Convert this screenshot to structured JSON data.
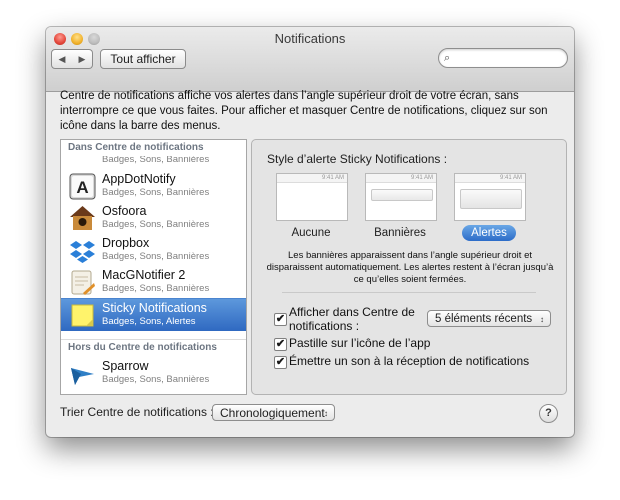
{
  "window": {
    "title": "Notifications",
    "toolbar": {
      "back_icon": "◀",
      "forward_icon": "▶",
      "show_all_label": "Tout afficher",
      "search_icon": "🔍",
      "search_value": ""
    }
  },
  "description": "Centre de notifications affiche vos alertes dans l’angle supérieur droit de votre écran, sans interrompre ce que vous faites. Pour afficher et masquer Centre de notifications, cliquez sur son icône dans la barre des menus.",
  "sidebar": {
    "section_in": "Dans Centre de notifications",
    "partial_item_sub": "Badges, Sons, Bannières",
    "items": [
      {
        "name": "AppDotNotify",
        "sub": "Badges, Sons, Bannières"
      },
      {
        "name": "Osfoora",
        "sub": "Badges, Sons, Bannières"
      },
      {
        "name": "Dropbox",
        "sub": "Badges, Sons, Bannières"
      },
      {
        "name": "MacGNotifier 2",
        "sub": "Badges, Sons, Bannières"
      },
      {
        "name": "Sticky Notifications",
        "sub": "Badges, Sons, Alertes"
      }
    ],
    "section_out": "Hors du Centre de notifications",
    "out_items": [
      {
        "name": "Sparrow",
        "sub": "Badges, Sons, Bannières"
      }
    ],
    "selected_color": "#2f69c1"
  },
  "detail": {
    "style_title": "Style d’alerte Sticky Notifications :",
    "clock_text": "9:41 AM",
    "styles": [
      "Aucune",
      "Bannières",
      "Alertes"
    ],
    "selected_style": "Alertes",
    "explanation": "Les bannières apparaissent dans l’angle supérieur droit et disparaissent automatiquement. Les alertes restent à l’écran jusqu’à ce qu’elles soient fermées.",
    "checkbox_show_in_center": "Afficher dans Centre de notifications :",
    "recent_items_value": "5 éléments récents",
    "checkbox_badge": "Pastille sur l’icône de l’app",
    "checkbox_sound": "Émettre un son à la réception de notifications",
    "checkmark": "✔"
  },
  "footer": {
    "sort_label": "Trier Centre de notifications :",
    "sort_value": "Chronologiquement",
    "help_label": "?"
  }
}
